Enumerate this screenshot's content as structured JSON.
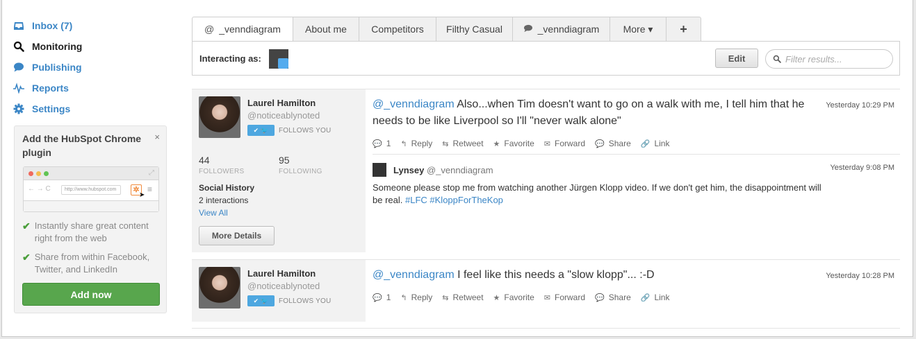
{
  "sidebar": {
    "items": [
      {
        "label": "Inbox (7)",
        "icon": "inbox-icon",
        "active": false
      },
      {
        "label": "Monitoring",
        "icon": "search-icon",
        "active": true
      },
      {
        "label": "Publishing",
        "icon": "speech-bubble-icon",
        "active": false
      },
      {
        "label": "Reports",
        "icon": "pulse-icon",
        "active": false
      },
      {
        "label": "Settings",
        "icon": "gear-icon",
        "active": false
      }
    ],
    "promo": {
      "title": "Add the HubSpot Chrome plugin",
      "close": "×",
      "url": "http://www.hubspot.com",
      "features": [
        "Instantly share great content right from the web",
        "Share from within Facebook, Twitter, and LinkedIn"
      ],
      "button": "Add now"
    }
  },
  "tabs": [
    {
      "label": "_venndiagram",
      "prefix": "@",
      "active": true
    },
    {
      "label": "About me",
      "prefix": "",
      "active": false
    },
    {
      "label": "Competitors",
      "prefix": "",
      "active": false
    },
    {
      "label": "Filthy Casual",
      "prefix": "",
      "active": false
    },
    {
      "label": "_venndiagram",
      "prefix": "speech",
      "active": false
    },
    {
      "label": "More ▾",
      "prefix": "",
      "active": false
    },
    {
      "label": "+",
      "prefix": "",
      "active": false
    }
  ],
  "toolbar": {
    "interacting_label": "Interacting as:",
    "edit_label": "Edit",
    "filter_placeholder": "Filter results..."
  },
  "conversations": [
    {
      "name": "Laurel Hamilton",
      "handle": "@noticeablynoted",
      "follows": "FOLLOWS YOU",
      "followers": "44",
      "followers_label": "FOLLOWERS",
      "following": "95",
      "following_label": "FOLLOWING",
      "history_title": "Social History",
      "history_count": "2 interactions",
      "view_all": "View All",
      "details": "More Details",
      "mention": "@_venndiagram",
      "text": " Also...when Tim doesn't want to go on a walk with me, I tell him that he needs to be like Liverpool so I'll \"never walk alone\"",
      "time": "Yesterday 10:29 PM",
      "actions": {
        "comments": "1",
        "reply": "Reply",
        "retweet": "Retweet",
        "favorite": "Favorite",
        "forward": "Forward",
        "share": "Share",
        "link": "Link"
      },
      "reply": {
        "name": "Lynsey",
        "handle": "@_venndiagram",
        "time": "Yesterday 9:08 PM",
        "text": "Someone please stop me from watching another Jürgen Klopp video. If we don't get him, the disappointment will be real. ",
        "tag1": "#LFC",
        "tag2": "#KloppForTheKop"
      }
    },
    {
      "name": "Laurel Hamilton",
      "handle": "@noticeablynoted",
      "follows": "FOLLOWS YOU",
      "mention": "@_venndiagram",
      "text": " I feel like this needs a \"slow klopp\"... :-D",
      "time": "Yesterday 10:28 PM",
      "actions": {
        "comments": "1",
        "reply": "Reply",
        "retweet": "Retweet",
        "favorite": "Favorite",
        "forward": "Forward",
        "share": "Share",
        "link": "Link"
      }
    }
  ],
  "colors": {
    "link": "#3b86c6",
    "cta": "#58a64d",
    "twitter": "#4ea7e0"
  }
}
